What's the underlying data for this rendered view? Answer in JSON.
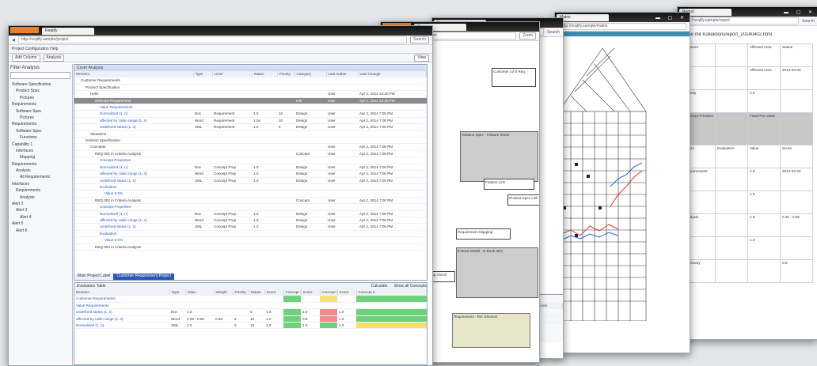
{
  "brand_color": "#e8822a",
  "main": {
    "tab_title": "Reqtify",
    "url": "http://reqtify.sample/project",
    "menu": "Project  Configuration  Help",
    "search_placeholder": "Search",
    "toolbar": {
      "add": "Add Column",
      "analyze": "Analysis",
      "view": "View"
    },
    "panel_title": "Cover Analysis",
    "sidebar": {
      "filter_label": "Filter Analysis",
      "filter_value": "",
      "items": [
        "Software Specification",
        "Product Spec",
        "Pictures",
        "Requirements",
        "Software Spec",
        "Pictures",
        "Requirements",
        "Software Spec",
        "Functions",
        "Capability 1",
        "Interfaces",
        "Mapping",
        "Requirements",
        "Analysis",
        "All Requirements",
        "Interfaces",
        "Requirements",
        "Analysis",
        "Alert 2",
        "Alert 3",
        "Alert 4",
        "Alert 5",
        "Alert 6"
      ]
    },
    "columns": [
      "Element",
      "Type",
      "Level",
      "Status",
      "Priority",
      "Category",
      "Last Author",
      "Last Change"
    ],
    "rows": [
      {
        "indent": 1,
        "name": "Customer Requirements",
        "type": "",
        "level": "",
        "status": "",
        "prio": "",
        "cat": "",
        "author": "",
        "date": ""
      },
      {
        "indent": 2,
        "name": "Product Specification",
        "type": "",
        "level": "",
        "status": "",
        "prio": "",
        "cat": "",
        "author": "",
        "date": ""
      },
      {
        "indent": 3,
        "name": "Hello",
        "type": "",
        "level": "",
        "status": "",
        "prio": "",
        "cat": "",
        "author": "User",
        "date": "Apr 2, 2014 12:30 PM"
      },
      {
        "indent": 4,
        "name": "Selected Requirement",
        "type": "",
        "level": "",
        "status": "",
        "prio": "",
        "cat": "Info",
        "author": "User",
        "date": "Apr 2, 2014 12:30 PM",
        "sel": true
      },
      {
        "indent": 5,
        "name": "Value Requirements",
        "type": "",
        "level": "",
        "status": "",
        "prio": "",
        "cat": "",
        "author": "",
        "date": ""
      },
      {
        "indent": 5,
        "name": "Normalized (1..n)",
        "type": "Doc",
        "level": "Requirement",
        "status": "1.0",
        "prio": "10",
        "cat": "Design",
        "author": "User",
        "date": "Apr 2, 2014 7:00 PM"
      },
      {
        "indent": 5,
        "name": "affected by cabin range (1..n)",
        "type": "Word",
        "level": "Requirement",
        "status": "1.0a",
        "prio": "10",
        "cat": "Design",
        "author": "User",
        "date": "Apr 2, 2014 7:00 PM"
      },
      {
        "indent": 5,
        "name": "undefined status (1..n)",
        "type": "XML",
        "level": "Requirement",
        "status": "1.0",
        "prio": "5",
        "cat": "Design",
        "author": "User",
        "date": "Apr 2, 2014 7:00 PM"
      },
      {
        "indent": 3,
        "name": "Situations",
        "type": "",
        "level": "",
        "status": "",
        "prio": "",
        "cat": "",
        "author": "",
        "date": ""
      },
      {
        "indent": 2,
        "name": "Solution Specification",
        "type": "",
        "level": "",
        "status": "",
        "prio": "",
        "cat": "",
        "author": "",
        "date": ""
      },
      {
        "indent": 3,
        "name": "Concepts",
        "type": "",
        "level": "",
        "status": "",
        "prio": "",
        "cat": "",
        "author": "User",
        "date": "Apr 2, 2014 7:00 PM"
      },
      {
        "indent": 4,
        "name": "REQ 001 in Criteria Analysis",
        "type": "",
        "level": "",
        "status": "",
        "prio": "",
        "cat": "Concept",
        "author": "User",
        "date": "Apr 2, 2014 7:00 PM"
      },
      {
        "indent": 5,
        "name": "Concept Properties",
        "type": "",
        "level": "",
        "status": "",
        "prio": "",
        "cat": "",
        "author": "",
        "date": ""
      },
      {
        "indent": 5,
        "name": "Normalized (1..n)",
        "type": "Doc",
        "level": "Concept Prop",
        "status": "1.0",
        "prio": "",
        "cat": "Design",
        "author": "User",
        "date": "Apr 2, 2014 7:00 PM"
      },
      {
        "indent": 5,
        "name": "affected by cabin range (1..n)",
        "type": "Word",
        "level": "Concept Prop",
        "status": "1.0",
        "prio": "",
        "cat": "Design",
        "author": "User",
        "date": "Apr 2, 2014 7:00 PM"
      },
      {
        "indent": 5,
        "name": "undefined status (1..n)",
        "type": "XML",
        "level": "Concept Prop",
        "status": "1.0",
        "prio": "",
        "cat": "Design",
        "author": "User",
        "date": "Apr 2, 2014 7:00 PM"
      },
      {
        "indent": 5,
        "name": "Evaluation",
        "type": "",
        "level": "",
        "status": "",
        "prio": "",
        "cat": "",
        "author": "",
        "date": ""
      },
      {
        "indent": 6,
        "name": "Value 8.5%",
        "type": "",
        "level": "",
        "status": "",
        "prio": "",
        "cat": "",
        "author": "",
        "date": ""
      },
      {
        "indent": 4,
        "name": "REQ 002 in Criteria Analysis",
        "type": "",
        "level": "",
        "status": "",
        "prio": "",
        "cat": "Concept",
        "author": "User",
        "date": "Apr 2, 2014 7:00 PM"
      },
      {
        "indent": 5,
        "name": "Concept Properties",
        "type": "",
        "level": "",
        "status": "",
        "prio": "",
        "cat": "",
        "author": "",
        "date": ""
      },
      {
        "indent": 5,
        "name": "Normalized (1..n)",
        "type": "Doc",
        "level": "Concept Prop",
        "status": "1.0",
        "prio": "",
        "cat": "Design",
        "author": "User",
        "date": "Apr 2, 2014 7:00 PM"
      },
      {
        "indent": 5,
        "name": "affected by cabin range (1..n)",
        "type": "Word",
        "level": "Concept Prop",
        "status": "1.0",
        "prio": "",
        "cat": "Design",
        "author": "User",
        "date": "Apr 2, 2014 7:00 PM"
      },
      {
        "indent": 5,
        "name": "undefined status (1..n)",
        "type": "XML",
        "level": "Concept Prop",
        "status": "1.0",
        "prio": "",
        "cat": "Design",
        "author": "User",
        "date": "Apr 2, 2014 7:00 PM"
      },
      {
        "indent": 5,
        "name": "Evaluation",
        "type": "",
        "level": "",
        "status": "",
        "prio": "",
        "cat": "",
        "author": "",
        "date": ""
      },
      {
        "indent": 6,
        "name": "Value 8.5%",
        "type": "",
        "level": "",
        "status": "",
        "prio": "",
        "cat": "",
        "author": "",
        "date": ""
      },
      {
        "indent": 4,
        "name": "REQ 003 in Criteria Analysis",
        "type": "",
        "level": "",
        "status": "",
        "prio": "",
        "cat": "",
        "author": "",
        "date": ""
      }
    ],
    "bottom_tabs": [
      "Main Project Label",
      "Customer Requirement Project"
    ],
    "bottom_panel_title": "Evaluation Table",
    "bottom_actions": [
      "Calculate",
      "Show all Concepts"
    ],
    "bottom_columns": [
      "Element",
      "Type",
      "Value",
      "Weight",
      "Priority",
      "Status",
      "Score",
      "Concept 1",
      "Score",
      "Concept 2",
      "Score",
      "Concept 3"
    ],
    "bottom_rows": [
      {
        "name": "Customer Requirements",
        "c": [
          "",
          "",
          "",
          "",
          "",
          "",
          "g",
          "",
          "y",
          "",
          "g"
        ]
      },
      {
        "name": "Value Requirements",
        "c": [
          "",
          "",
          "",
          "",
          "",
          "",
          "",
          "",
          "",
          "",
          ""
        ]
      },
      {
        "name": "undefined status (1..n)",
        "c": [
          "Doc",
          "1.0",
          "",
          "",
          "5",
          "1.0",
          "g",
          "1.0",
          "r",
          "1.0",
          "g"
        ]
      },
      {
        "name": "affected by cabin range (1..n)",
        "c": [
          "Word",
          "0.25 - 0.55",
          "0.25",
          "2",
          "10",
          "1.0",
          "g",
          "0.5",
          "r",
          "1.0",
          "g"
        ]
      },
      {
        "name": "Normalized (1..n)",
        "c": [
          "XML",
          "1.0",
          "",
          "5",
          "10",
          "1.0",
          "g",
          "1.0",
          "g",
          "1.0",
          "y"
        ]
      }
    ]
  },
  "w2": {
    "tab_title": "Diagram",
    "url": "http://reqtify.sample/diagram",
    "search_placeholder": "Search",
    "select_value": "Zoom",
    "nodes": [
      {
        "label": "Customer Spec",
        "kind": "white"
      },
      {
        "label": "Customer Lvl 0 Req",
        "kind": "white"
      },
      {
        "label": "Solution Spec - Feature Sheet",
        "kind": "gray"
      },
      {
        "label": "Feature Link",
        "kind": "white"
      },
      {
        "label": "Requirement Mapping",
        "kind": "white"
      },
      {
        "label": "Product Spec Link",
        "kind": "white"
      },
      {
        "label": "E-Book Model - E-Book Item",
        "kind": "gray"
      },
      {
        "label": "Mapping Check",
        "kind": "white"
      },
      {
        "label": "Requirement - Rel. Element",
        "kind": "khaki"
      }
    ]
  },
  "w3": {
    "tab_title": "Matrix",
    "url": "http://reqtify.sample/matrix",
    "footer_title": "Customer Requirements",
    "footer_columns": [
      "Element",
      "Status",
      "Coverage Score"
    ],
    "footer_rows": [
      [
        "Req: Product Specification: Apps",
        "1.0",
        "0.92"
      ],
      [
        "Req: Product Specification: Core",
        "1.0",
        "0.81"
      ]
    ]
  },
  "w5": {
    "tab_title": "Report",
    "url": "http://reqtify.sample/report",
    "search_placeholder": "Search",
    "page_title": "Page mit Kollektionsreport_20140402.html",
    "rows": [
      [
        "Element",
        "",
        "Affected Area",
        "Status"
      ],
      [
        "",
        "",
        "Affected Area",
        "2014-04-02"
      ],
      [
        "Priority",
        "",
        "2.0",
        ""
      ],
      [
        "Concept Priorities",
        "",
        "Final Prio Value",
        ""
      ],
      [
        "Score",
        "Evaluation",
        "Value",
        "Score"
      ],
      [
        "Requirements",
        "",
        "1.0",
        "2014-04-02"
      ],
      [
        "",
        "",
        "1.0",
        ""
      ],
      [
        "Analysis",
        "",
        "1.0",
        "0.25 - 0.55"
      ],
      [
        "",
        "",
        "1.0",
        ""
      ],
      [
        "Summary",
        "",
        "",
        "0.5"
      ]
    ]
  }
}
